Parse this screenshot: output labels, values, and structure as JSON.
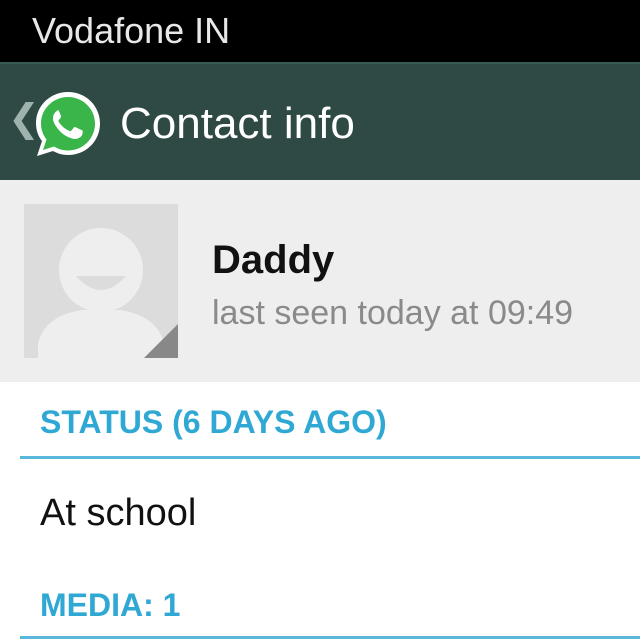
{
  "status_bar": {
    "carrier": "Vodafone IN"
  },
  "action_bar": {
    "back_icon": "chevron-left-icon",
    "app_icon": "whatsapp-icon",
    "title": "Contact info",
    "background_color": "#2f4a45"
  },
  "contact": {
    "name": "Daddy",
    "last_seen": "last seen today at 09:49",
    "avatar_icon": "default-avatar-icon"
  },
  "status_section": {
    "header": "STATUS (6 DAYS AGO)",
    "text": "At school"
  },
  "media_section": {
    "header": "MEDIA: 1"
  },
  "colors": {
    "accent": "#2fa8d4",
    "whatsapp_green": "#3ab54a"
  }
}
